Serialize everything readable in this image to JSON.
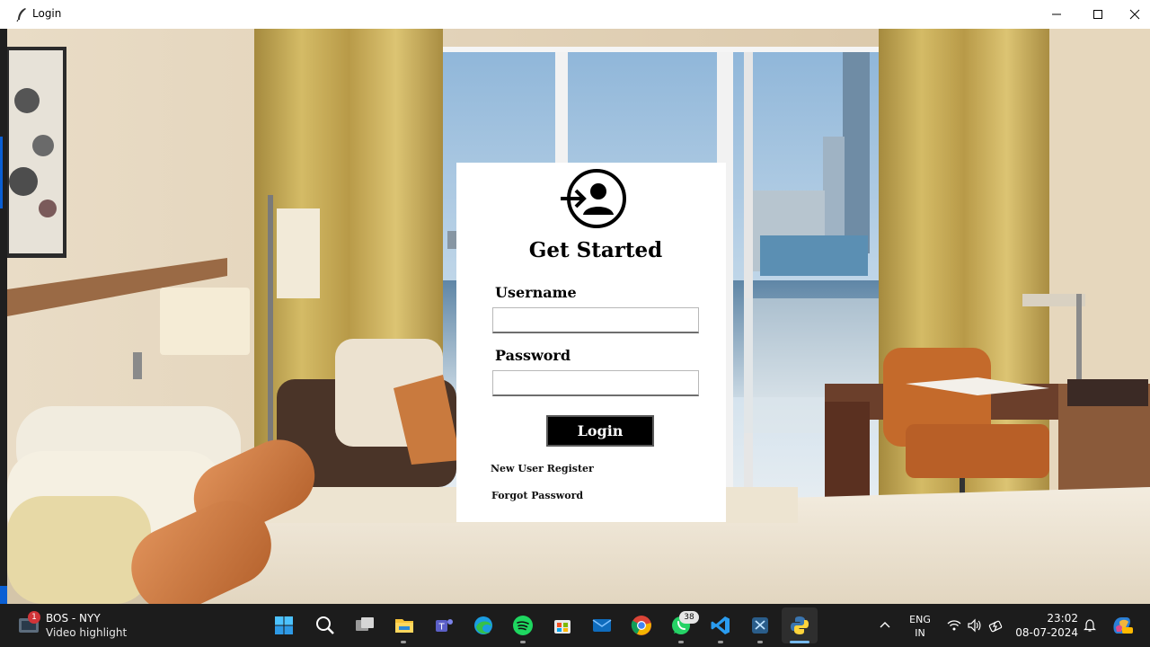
{
  "window": {
    "title": "Login",
    "minimize_icon": "minimize-icon",
    "maximize_icon": "maximize-icon",
    "close_icon": "close-icon"
  },
  "form": {
    "heading": "Get Started",
    "username_label": "Username",
    "username_value": "",
    "password_label": "Password",
    "password_value": "",
    "login_button": "Login",
    "register_link": "New User Register",
    "forgot_link": "Forgot Password"
  },
  "taskbar": {
    "news_badge": "1",
    "news_title": "BOS - NYY",
    "news_subtitle": "Video highlight",
    "whatsapp_badge": "38",
    "apps": [
      "start-icon",
      "search-icon",
      "task-view-icon",
      "file-explorer-icon",
      "teams-icon",
      "edge-icon",
      "spotify-icon",
      "store-icon",
      "mail-icon",
      "chrome-icon",
      "whatsapp-icon",
      "vscode-icon",
      "snipping-icon",
      "python-icon"
    ],
    "language_line1": "ENG",
    "language_line2": "IN",
    "time": "23:02",
    "date": "08-07-2024"
  },
  "colors": {
    "card_bg": "#ffffff",
    "button_bg": "#000000",
    "taskbar_bg": "#1c1c1c"
  }
}
